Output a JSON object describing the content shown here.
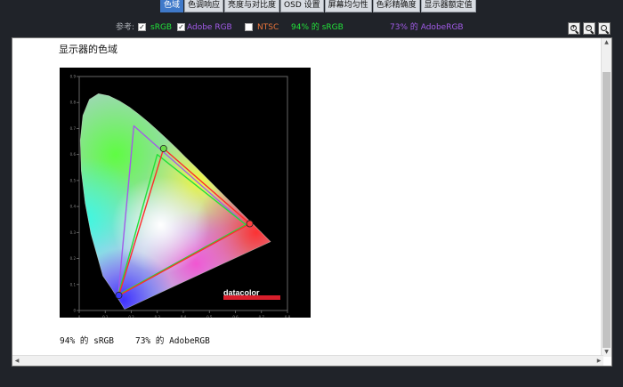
{
  "tabs": [
    {
      "label": "色域",
      "active": true
    },
    {
      "label": "色调响应",
      "active": false
    },
    {
      "label": "亮度与对比度",
      "active": false
    },
    {
      "label": "OSD 设置",
      "active": false
    },
    {
      "label": "屏幕均匀性",
      "active": false
    },
    {
      "label": "色彩精确度",
      "active": false
    },
    {
      "label": "显示器额定值",
      "active": false
    }
  ],
  "toolbar": {
    "reference_label": "参考:",
    "srgb_label": "sRGB",
    "srgb_checked": true,
    "adobe_label": "Adobe RGB",
    "adobe_checked": true,
    "ntsc_label": "NTSC",
    "ntsc_checked": false,
    "srgb_coverage": "94% 的 sRGB",
    "adobe_coverage": "73% 的 AdobeRGB",
    "zoom_in_icon": "zoom-in-icon",
    "zoom_out_icon": "zoom-out-icon",
    "zoom_fit_icon": "zoom-fit-icon"
  },
  "content": {
    "section_title": "显示器的色域",
    "summary_srgb": "94% 的 sRGB",
    "summary_adobe": "73% 的 AdobeRGB"
  },
  "colors": {
    "active_tab": "#3f79c9",
    "srgb_green": "#22e03a",
    "adobe_purple": "#a25be8",
    "ntsc_orange": "#e8743a",
    "measured_red": "#ff2b2b"
  },
  "chart_data": {
    "type": "scatter",
    "title": "",
    "xlabel": "",
    "ylabel": "",
    "xlim": [
      0,
      0.8
    ],
    "ylim": [
      0,
      0.9
    ],
    "x_ticks": [
      "0",
      "0.1",
      "0.2",
      "0.3",
      "0.4",
      "0.5",
      "0.6",
      "0.7",
      "0.8"
    ],
    "y_ticks": [
      "0",
      "0.1",
      "0.2",
      "0.3",
      "0.4",
      "0.5",
      "0.6",
      "0.7",
      "0.8",
      "0.9"
    ],
    "brand": "datacolor",
    "spectral_locus": [
      [
        0.175,
        0.005
      ],
      [
        0.174,
        0.005
      ],
      [
        0.171,
        0.01
      ],
      [
        0.166,
        0.018
      ],
      [
        0.156,
        0.035
      ],
      [
        0.144,
        0.053
      ],
      [
        0.124,
        0.085
      ],
      [
        0.091,
        0.133
      ],
      [
        0.045,
        0.295
      ],
      [
        0.023,
        0.413
      ],
      [
        0.008,
        0.538
      ],
      [
        0.004,
        0.655
      ],
      [
        0.014,
        0.75
      ],
      [
        0.039,
        0.812
      ],
      [
        0.074,
        0.834
      ],
      [
        0.114,
        0.826
      ],
      [
        0.155,
        0.806
      ],
      [
        0.193,
        0.782
      ],
      [
        0.23,
        0.754
      ],
      [
        0.266,
        0.724
      ],
      [
        0.302,
        0.692
      ],
      [
        0.337,
        0.659
      ],
      [
        0.373,
        0.625
      ],
      [
        0.408,
        0.59
      ],
      [
        0.444,
        0.555
      ],
      [
        0.479,
        0.52
      ],
      [
        0.512,
        0.487
      ],
      [
        0.547,
        0.452
      ],
      [
        0.575,
        0.424
      ],
      [
        0.602,
        0.397
      ],
      [
        0.627,
        0.372
      ],
      [
        0.648,
        0.351
      ],
      [
        0.666,
        0.334
      ],
      [
        0.68,
        0.32
      ],
      [
        0.69,
        0.31
      ],
      [
        0.698,
        0.302
      ],
      [
        0.705,
        0.295
      ],
      [
        0.714,
        0.286
      ],
      [
        0.735,
        0.265
      ]
    ],
    "series": [
      {
        "name": "sRGB",
        "points": [
          [
            0.64,
            0.33
          ],
          [
            0.3,
            0.6
          ],
          [
            0.15,
            0.06
          ]
        ]
      },
      {
        "name": "Adobe RGB",
        "points": [
          [
            0.64,
            0.33
          ],
          [
            0.21,
            0.71
          ],
          [
            0.15,
            0.06
          ]
        ]
      },
      {
        "points": [
          [
            0.655,
            0.334
          ],
          [
            0.324,
            0.623
          ],
          [
            0.152,
            0.058
          ]
        ]
      }
    ],
    "white_point": [
      0.313,
      0.329
    ],
    "grid": false,
    "legend": "none"
  }
}
